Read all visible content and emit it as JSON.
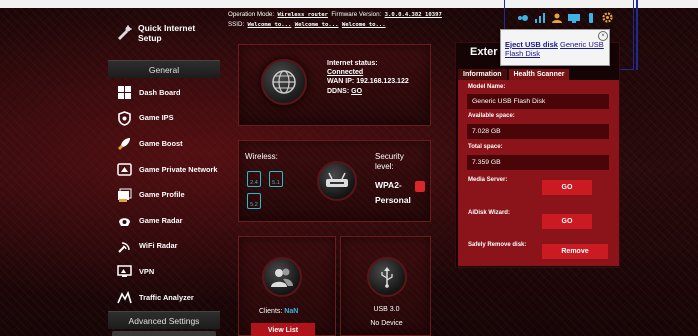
{
  "header": {
    "operation_mode_key": "Operation Mode:",
    "operation_mode_value": "Wireless router",
    "firmware_key": "Firmware Version:",
    "firmware_value": "3.0.0.4.382_10397",
    "ssid_key": "SSID:",
    "ssid_values": [
      "Welcome to...",
      "Welcome to...",
      "Welcome to..."
    ],
    "icons": [
      "devices-icon",
      "signal-icon",
      "users-icon",
      "network-icon",
      "usb-icon",
      "gear-icon"
    ]
  },
  "sidebar": {
    "quick_setup": "Quick Internet Setup",
    "general_header": "General",
    "items": [
      {
        "label": "Dash Board",
        "icon": "dashboard-icon"
      },
      {
        "label": "Game IPS",
        "icon": "shield-icon"
      },
      {
        "label": "Game Boost",
        "icon": "rocket-icon"
      },
      {
        "label": "Game Private Network",
        "icon": "private-network-icon"
      },
      {
        "label": "Game Profile",
        "icon": "profile-icon"
      },
      {
        "label": "Game Radar",
        "icon": "radar-icon"
      },
      {
        "label": "WiFi Radar",
        "icon": "wifi-radar-icon"
      },
      {
        "label": "VPN",
        "icon": "vpn-icon"
      },
      {
        "label": "Traffic Analyzer",
        "icon": "traffic-icon"
      }
    ],
    "advanced_header": "Advanced Settings"
  },
  "internet": {
    "status_label": "Internet status:",
    "status_value": "Connected",
    "wan_ip_label": "WAN IP:",
    "wan_ip_value": "192.168.123.122",
    "ddns_label": "DDNS:",
    "ddns_value": "GO"
  },
  "wireless": {
    "label": "Wireless:",
    "bands": [
      "2.4",
      "5.1",
      "5.2"
    ],
    "security_label": "Security level:",
    "security_value": "WPA2-Personal"
  },
  "clients": {
    "label": "Clients:",
    "count": "NaN",
    "view_list": "View List"
  },
  "usb": {
    "type": "USB 3.0",
    "status": "No Device"
  },
  "external": {
    "title": "Exter",
    "tabs": [
      "Information",
      "Health Scanner"
    ],
    "model_label": "Model Name:",
    "model_value": "Generic USB Flash Disk",
    "available_label": "Available space:",
    "available_value": "7.028 GB",
    "total_label": "Total space:",
    "total_value": "7.359 GB",
    "media_server_label": "Media Server:",
    "media_server_btn": "GO",
    "aidisk_label": "AiDisk Wizard:",
    "aidisk_btn": "GO",
    "remove_label": "Safely Remove disk:",
    "remove_btn": "Remove"
  },
  "popup": {
    "eject": "Eject USB disk",
    "device": "Generic USB Flash Disk",
    "close": "×"
  }
}
